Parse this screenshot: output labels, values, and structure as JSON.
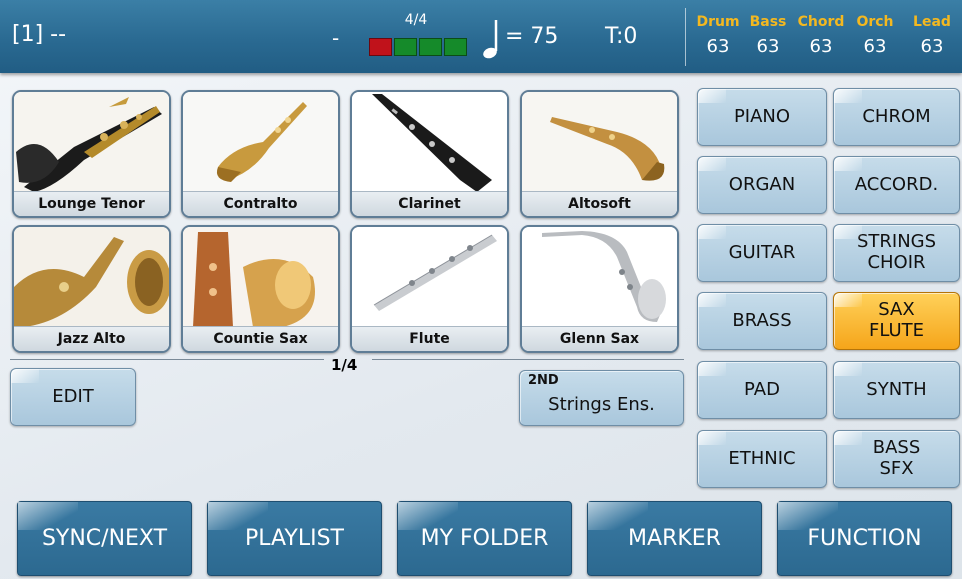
{
  "status": {
    "song": "[1] --",
    "dash": "-",
    "time_signature": "4/4",
    "beats_total": 4,
    "beat_current": 1,
    "tempo": "= 75",
    "transpose": "T:0",
    "mixer": [
      {
        "name": "Drum",
        "value": "63"
      },
      {
        "name": "Bass",
        "value": "63"
      },
      {
        "name": "Chord",
        "value": "63"
      },
      {
        "name": "Orch",
        "value": "63"
      },
      {
        "name": "Lead",
        "value": "63"
      }
    ]
  },
  "sounds": [
    {
      "label": "Lounge Tenor",
      "selected": true
    },
    {
      "label": "Contralto",
      "selected": false
    },
    {
      "label": "Clarinet",
      "selected": false
    },
    {
      "label": "Altosoft",
      "selected": false
    },
    {
      "label": "Jazz Alto",
      "selected": false
    },
    {
      "label": "Countie Sax",
      "selected": false
    },
    {
      "label": "Flute",
      "selected": false
    },
    {
      "label": "Glenn Sax",
      "selected": false
    }
  ],
  "page_indicator": "1/4",
  "edit_button": "EDIT",
  "second_sound": {
    "tag": "2ND",
    "value": "Strings Ens."
  },
  "families": [
    [
      "PIANO"
    ],
    [
      "CHROM"
    ],
    [
      "ORGAN"
    ],
    [
      "ACCORD."
    ],
    [
      "GUITAR"
    ],
    [
      "STRINGS",
      "CHOIR"
    ],
    [
      "BRASS"
    ],
    [
      "SAX",
      "FLUTE"
    ],
    [
      "PAD"
    ],
    [
      "SYNTH"
    ],
    [
      "ETHNIC"
    ],
    [
      "BASS",
      "SFX"
    ]
  ],
  "families_selected": [
    "SAX",
    "FLUTE"
  ],
  "bottom_bar": [
    "SYNC/NEXT",
    "PLAYLIST",
    "MY FOLDER",
    "MARKER",
    "FUNCTION"
  ],
  "colors": {
    "accent": "#2a6a92",
    "selected": "#f5a51a",
    "mixer_label": "#f3b820",
    "beat_active": "#c0121b",
    "beat_idle": "#158a2a"
  }
}
